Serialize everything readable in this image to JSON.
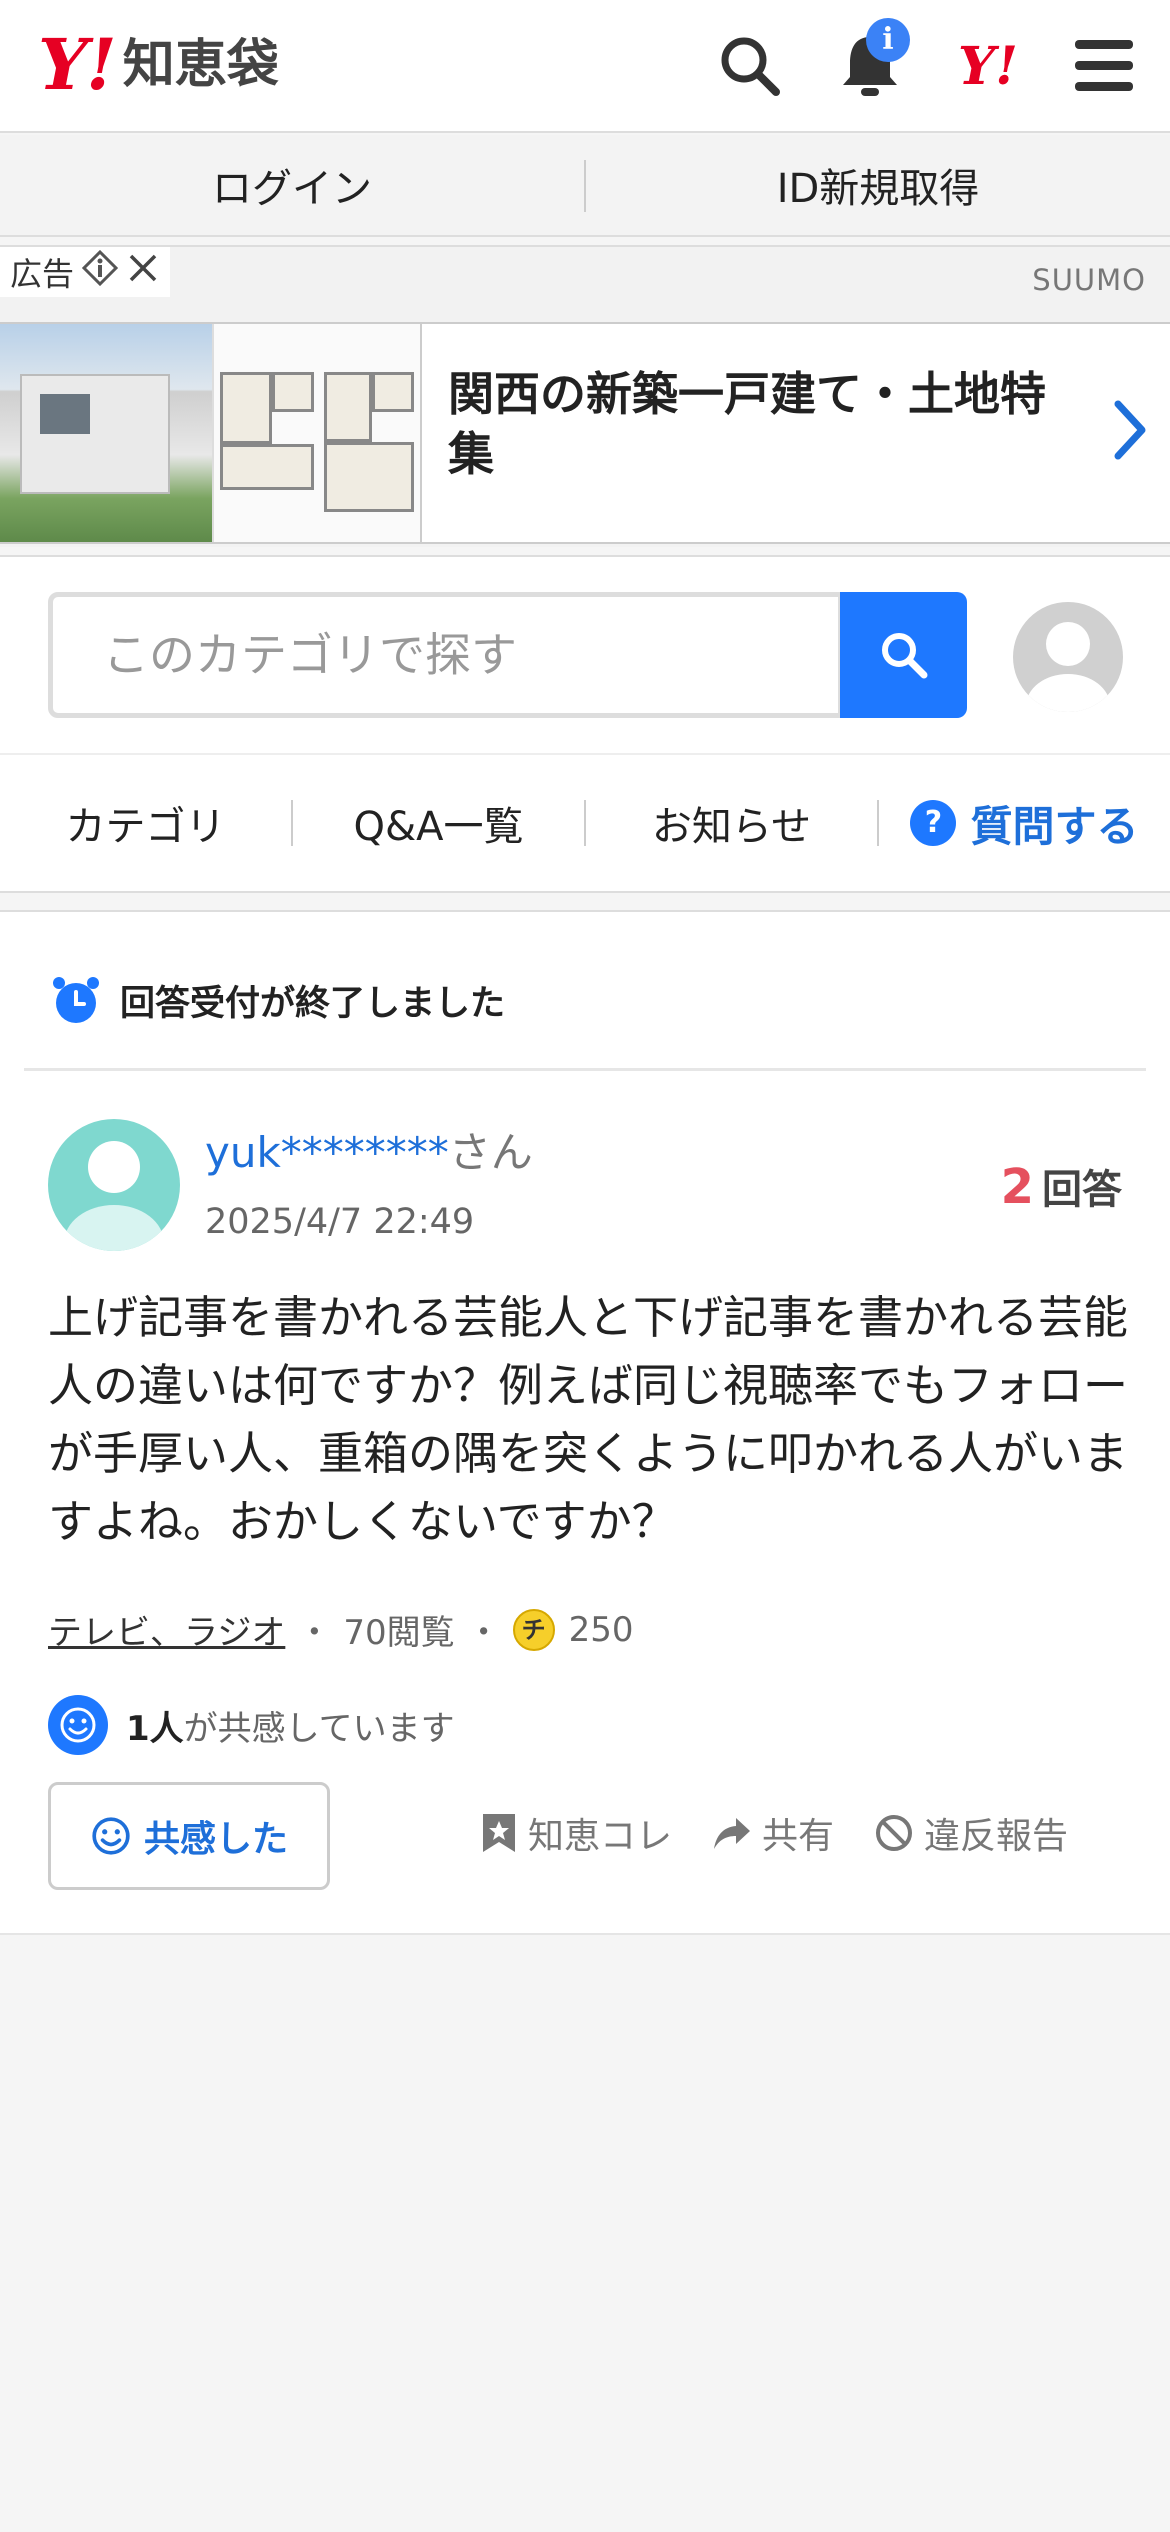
{
  "header": {
    "logo_mark": "Y!",
    "logo_text": "知恵袋",
    "notification_badge": "i",
    "yj_mark": "Y!"
  },
  "loginbar": {
    "login": "ログイン",
    "register": "ID新規取得"
  },
  "ad": {
    "label": "広告",
    "source": "SUUMO",
    "title": "関西の新築一戸建て・土地特集"
  },
  "search": {
    "placeholder": "このカテゴリで探す"
  },
  "nav": {
    "category": "カテゴリ",
    "qa_list": "Q&A一覧",
    "news": "お知らせ",
    "ask": "質問する"
  },
  "question": {
    "status": "回答受付が終了しました",
    "user_name": "yuk********",
    "user_suffix": "さん",
    "date": "2025/4/7 22:49",
    "answer_count": "2",
    "answer_label": "回答",
    "body": "上げ記事を書かれる芸能人と下げ記事を書かれる芸能人の違いは何ですか？例えば同じ視聴率でもフォローが手厚い人、重箱の隅を突くように叩かれる人がいますよね。おかしくないですか？",
    "category": "テレビ、ラジオ",
    "views": "70閲覧",
    "coin_mark": "チ",
    "coins": "250",
    "empathy_count": "1人",
    "empathy_text": "が共感しています",
    "empathy_button": "共感した",
    "bookmark": "知恵コレ",
    "share": "共有",
    "report": "違反報告"
  },
  "colors": {
    "brand_red": "#e60023",
    "accent_blue": "#1e78ff",
    "link_blue": "#1e6fd9",
    "answer_red": "#e5505e"
  }
}
